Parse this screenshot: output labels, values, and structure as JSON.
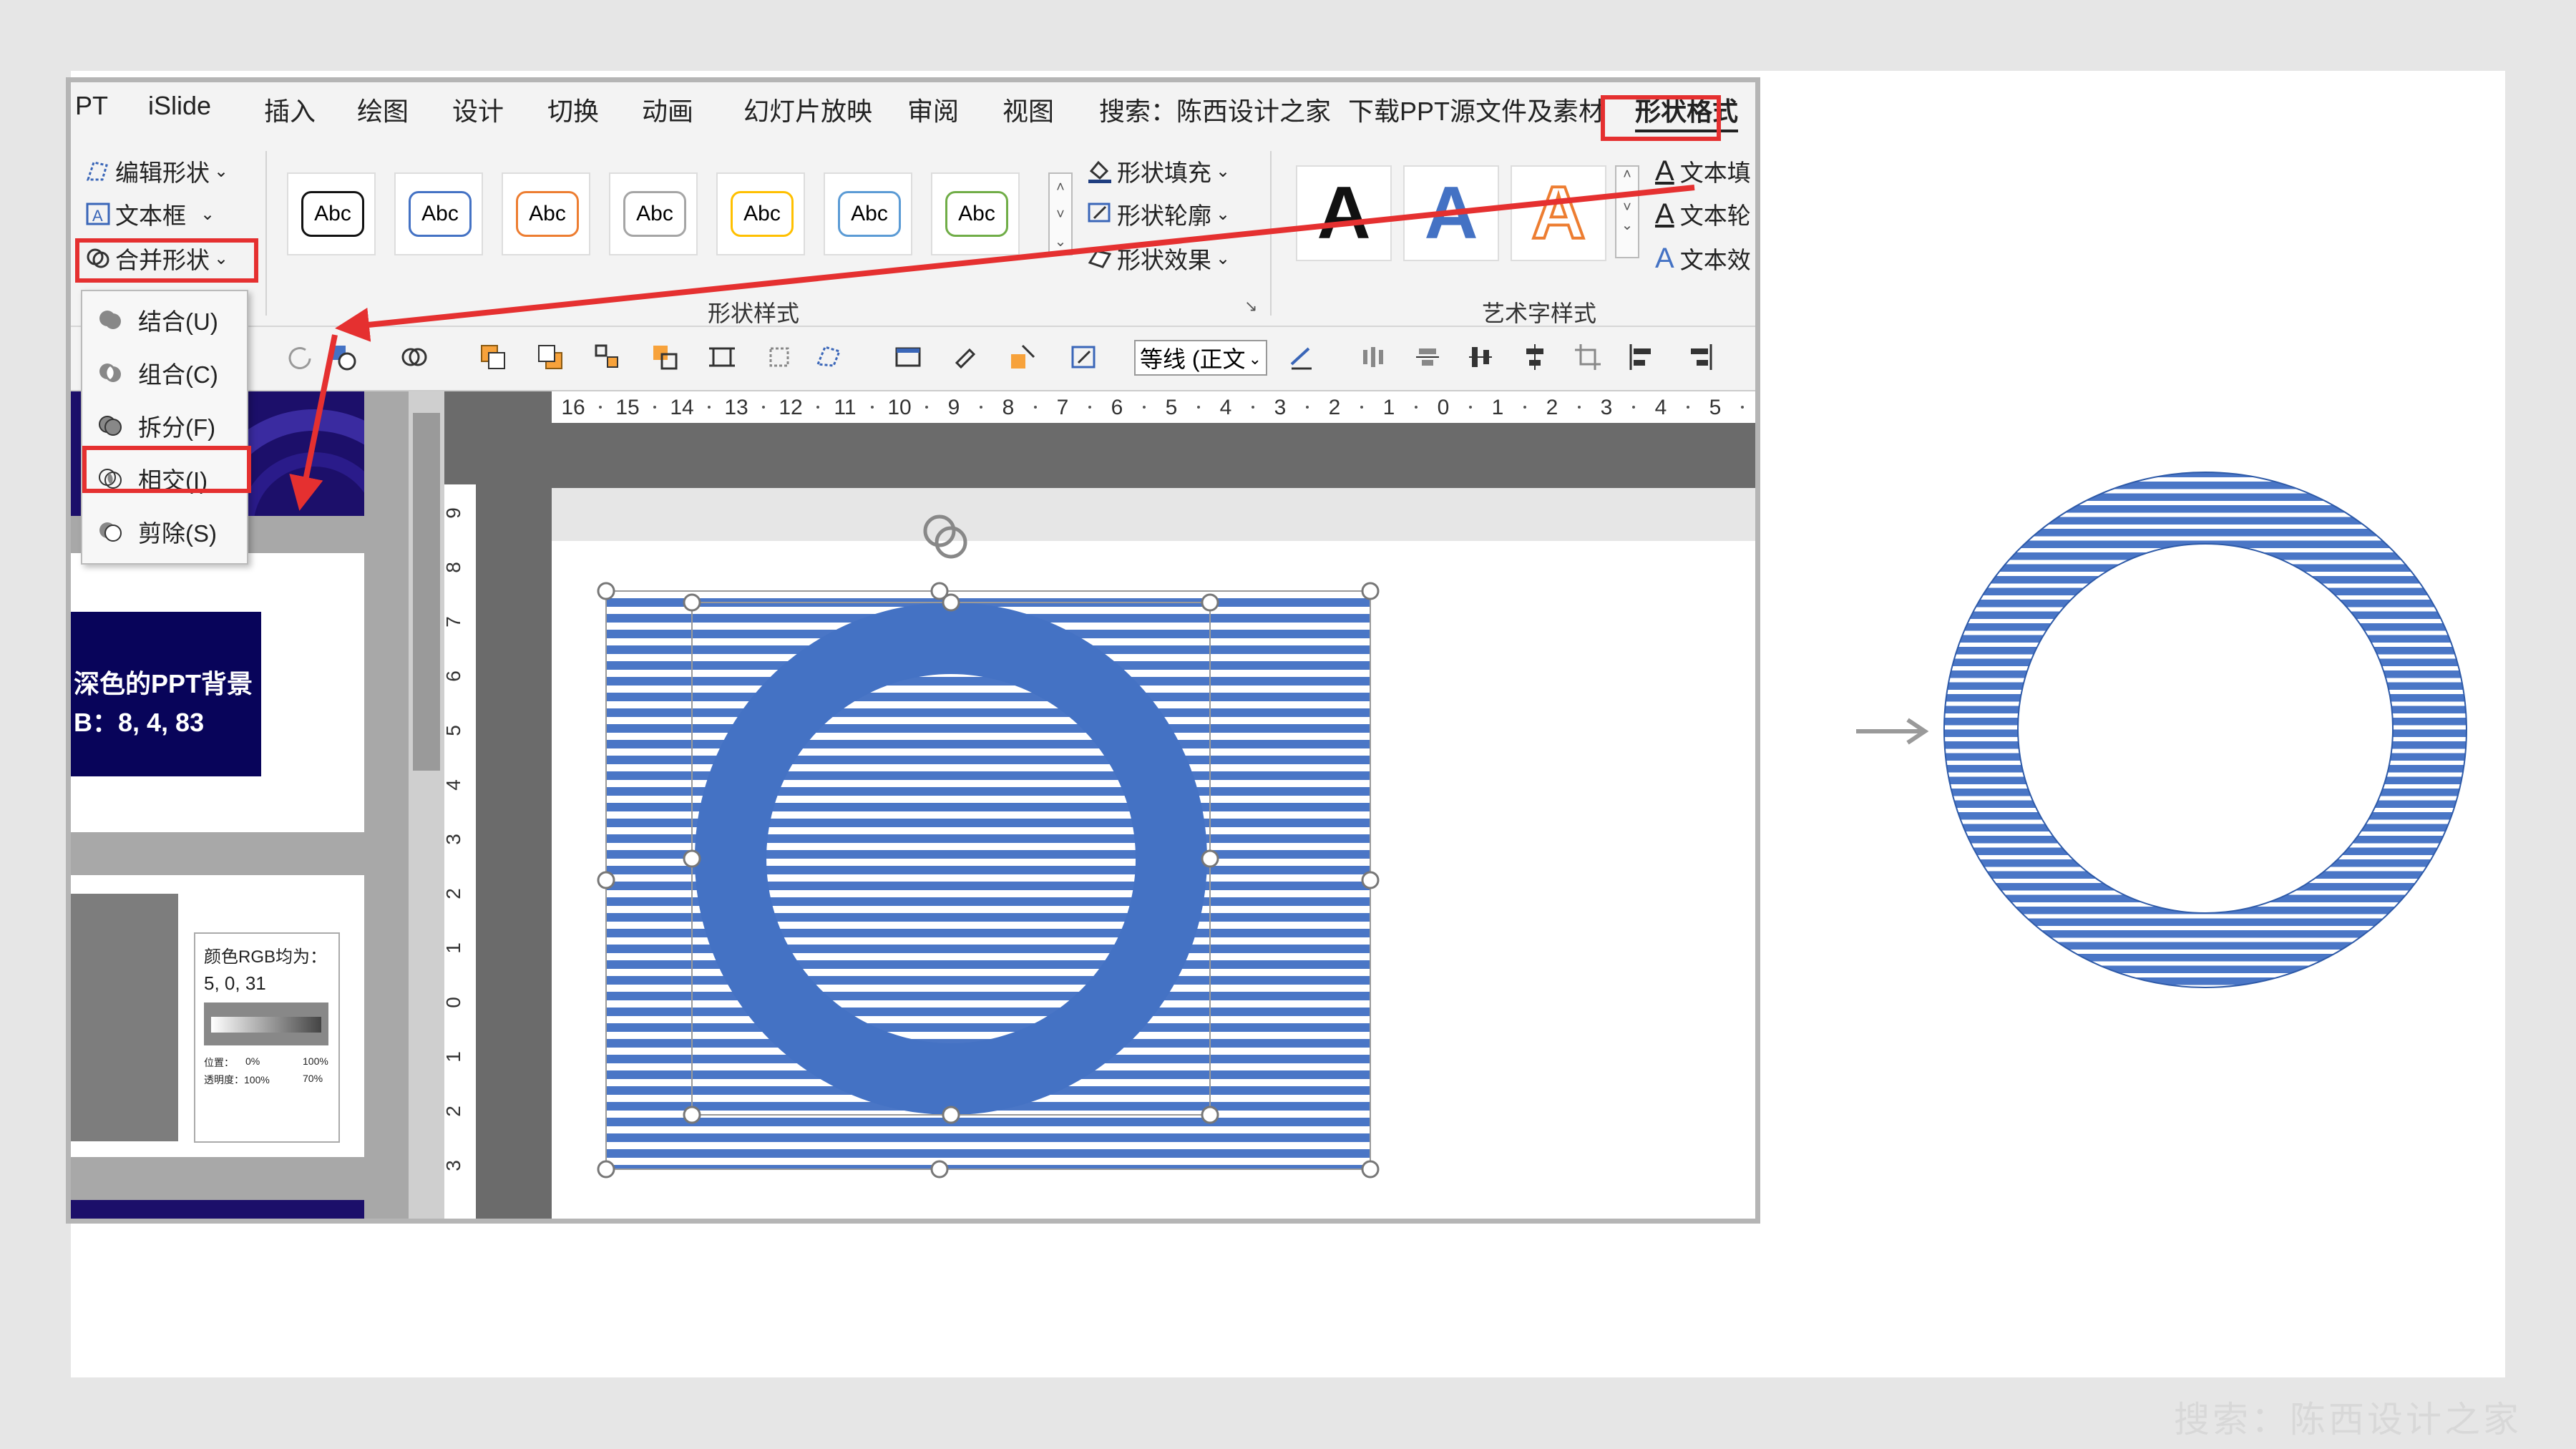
{
  "menubar": {
    "items": [
      "PT",
      "iSlide",
      "插入",
      "绘图",
      "设计",
      "切换",
      "动画",
      "幻灯片放映",
      "审阅",
      "视图",
      "搜索：陈西设计之家",
      "下载PPT源文件及素材"
    ],
    "active_tab": "形状格式"
  },
  "ribbon": {
    "edit_shape": "编辑形状",
    "textbox": "文本框",
    "merge_shapes": "合并形状",
    "style_thumb_label": "Abc",
    "shape_fill": "形状填充",
    "shape_outline": "形状轮廓",
    "shape_effect": "形状效果",
    "shape_styles_group": "形状样式",
    "wordart_letter": "A",
    "text_fill": "文本填",
    "text_outline": "文本轮",
    "text_effect": "文本效",
    "wordart_group": "艺术字样式",
    "font_name": "等线 (正文"
  },
  "merge_menu": {
    "items": [
      "结合(U)",
      "组合(C)",
      "拆分(F)",
      "相交(I)",
      "剪除(S)"
    ],
    "highlighted": "相交(I)"
  },
  "ruler": {
    "h_ticks": [
      "16",
      "15",
      "14",
      "13",
      "12",
      "11",
      "10",
      "9",
      "8",
      "7",
      "6",
      "5",
      "4",
      "3",
      "2",
      "1",
      "0",
      "1",
      "2",
      "3",
      "4",
      "5"
    ],
    "v_ticks": [
      "9",
      "8",
      "7",
      "6",
      "5",
      "4",
      "3",
      "2",
      "1",
      "0",
      "1",
      "2",
      "3"
    ]
  },
  "thumbnails": {
    "slide2_line1": "深色的PPT背景",
    "slide2_line2": "B：8, 4, 83",
    "slide3_note_title": "颜色RGB均为：",
    "slide3_note_value": "5, 0, 31",
    "slide3_pos_label": "位置：",
    "slide3_pos_a": "0%",
    "slide3_pos_b": "100%",
    "slide3_alpha_label": "透明度：100%",
    "slide3_alpha_b": "70%"
  },
  "watermark": "搜索：陈西设计之家",
  "colors": {
    "ring_blue": "#4472c4",
    "stripe_blue": "#4a76c6",
    "highlight_red": "#e53030",
    "dark_navy": "#08045a"
  }
}
